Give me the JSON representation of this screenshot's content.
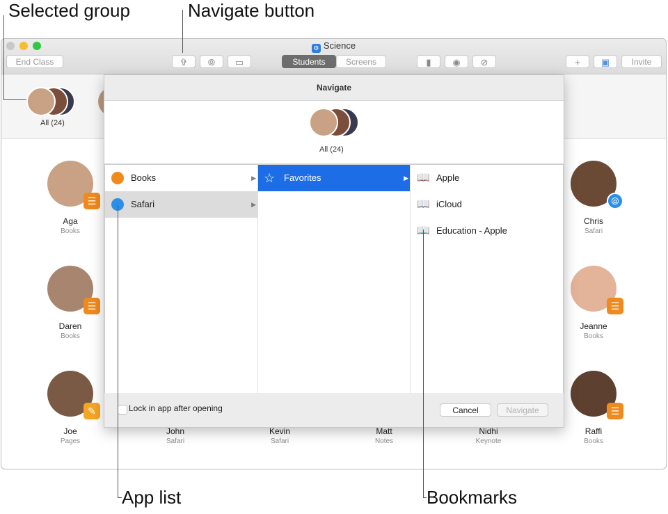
{
  "callouts": {
    "selected_group": "Selected group",
    "navigate_button": "Navigate button",
    "app_list": "App list",
    "bookmarks": "Bookmarks"
  },
  "window": {
    "title": "Science",
    "toolbar": {
      "end_class": "End Class",
      "segments": [
        "Students",
        "Screens"
      ],
      "invite": "Invite"
    }
  },
  "group": {
    "label": "All  (24)"
  },
  "students": [
    {
      "name": "Aga",
      "app": "Books",
      "badge": "books-icon",
      "color": "#c9a184"
    },
    {
      "name": "Daren",
      "app": "Books",
      "badge": "books-icon",
      "color": "#a8856e"
    },
    {
      "name": "Joe",
      "app": "Pages",
      "badge": "pages-icon",
      "color": "#7a5a45"
    },
    {
      "name": "John",
      "app": "Safari"
    },
    {
      "name": "Kevin",
      "app": "Safari"
    },
    {
      "name": "Matt",
      "app": "Notes"
    },
    {
      "name": "Nidhi",
      "app": "Keynote"
    },
    {
      "name": "Chris",
      "app": "Safari",
      "badge": "safari-icon",
      "color": "#6b4a35"
    },
    {
      "name": "Jeanne",
      "app": "Books",
      "badge": "books-icon",
      "color": "#e3b49a"
    },
    {
      "name": "Raffi",
      "app": "Books",
      "badge": "books-icon",
      "color": "#5e4030"
    }
  ],
  "sheet": {
    "title": "Navigate",
    "group_label": "All (24)",
    "apps": [
      {
        "label": "Books",
        "icon": "books-icon",
        "color": "#f08a1c"
      },
      {
        "label": "Safari",
        "icon": "safari-icon",
        "color": "#2a8fe8",
        "selected": true
      }
    ],
    "categories": [
      {
        "label": "Favorites",
        "icon": "star-icon",
        "selected": true
      }
    ],
    "bookmarks": [
      {
        "label": "Apple",
        "icon": "book-icon"
      },
      {
        "label": "iCloud",
        "icon": "book-icon"
      },
      {
        "label": "Education - Apple",
        "icon": "book-icon"
      }
    ],
    "lock_label": "Lock in app after opening",
    "cancel": "Cancel",
    "navigate": "Navigate"
  },
  "colors": {
    "accent": "#1d6ee6",
    "books": "#f08a1c",
    "safari": "#2a8fe8"
  }
}
